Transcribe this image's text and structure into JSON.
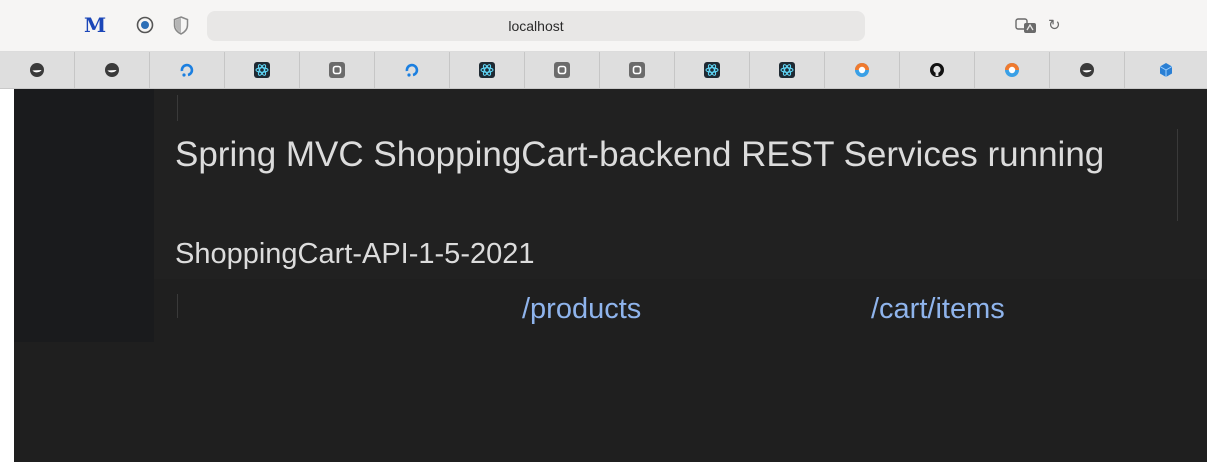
{
  "browser": {
    "url": "localhost",
    "toolbar_icons": [
      "m-logo-icon",
      "radio-icon",
      "shield-icon",
      "translate-icon",
      "reload-icon"
    ],
    "logo_letter": "M",
    "reload_glyph": "↻"
  },
  "favorites": [
    {
      "icon": "docker-whale-icon"
    },
    {
      "icon": "docker-whale-icon"
    },
    {
      "icon": "sync-blue-icon"
    },
    {
      "icon": "react-atom-icon"
    },
    {
      "icon": "o-badge-icon",
      "text": "O"
    },
    {
      "icon": "sync-blue-icon"
    },
    {
      "icon": "react-atom-icon"
    },
    {
      "icon": "o-badge-icon",
      "text": "O"
    },
    {
      "icon": "o-badge-icon",
      "text": "O"
    },
    {
      "icon": "react-atom-icon"
    },
    {
      "icon": "react-atom-icon"
    },
    {
      "icon": "eclipse-color-icon"
    },
    {
      "icon": "github-icon"
    },
    {
      "icon": "eclipse-color-icon"
    },
    {
      "icon": "docker-whale-icon"
    },
    {
      "icon": "blue-cube-icon"
    }
  ],
  "page": {
    "title": "Spring MVC ShoppingCart-backend REST Services running",
    "version": "ShoppingCart-API-1-5-2021",
    "links": {
      "products": "/products",
      "cart_items": "/cart/items"
    }
  },
  "colors": {
    "page_bg": "#1f1f1f",
    "text": "#dcdcdc",
    "link": "#8fb4ec"
  }
}
